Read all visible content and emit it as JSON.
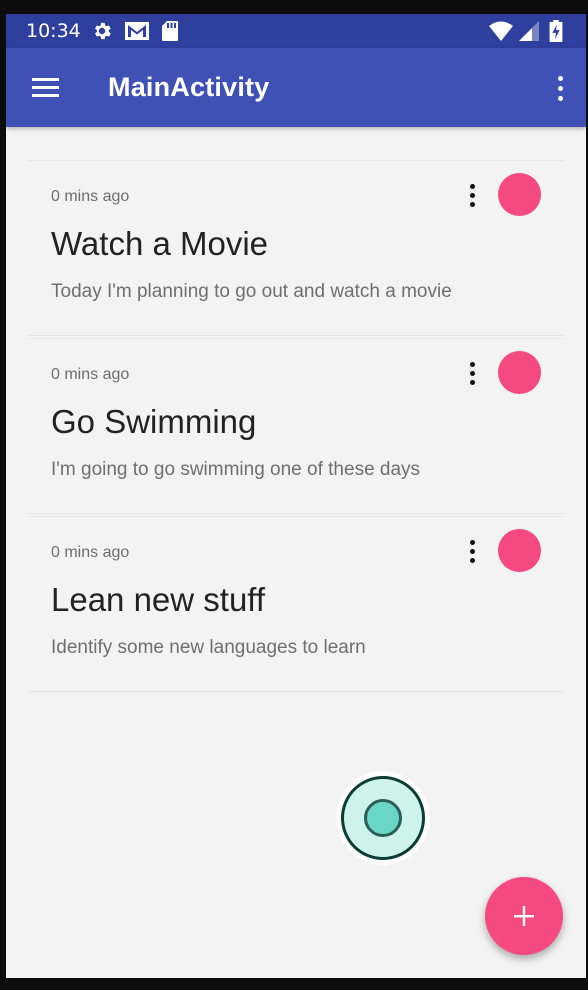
{
  "status_bar": {
    "time": "10:34",
    "icons": [
      "settings-icon",
      "gmail-icon",
      "sd-card-icon",
      "wifi-icon",
      "signal-icon",
      "battery-charging-icon"
    ]
  },
  "app_bar": {
    "title": "MainActivity",
    "nav_icon": "menu-icon",
    "overflow_icon": "more-vert-icon"
  },
  "notes": [
    {
      "time": "0 mins ago",
      "title": "Watch a Movie",
      "description": "Today I'm planning to go out and watch a movie"
    },
    {
      "time": "0 mins ago",
      "title": "Go Swimming",
      "description": "I'm going to go swimming one of these days"
    },
    {
      "time": "0 mins ago",
      "title": "Lean new stuff",
      "description": "Identify some new languages to learn"
    }
  ],
  "fab": {
    "icon": "add-icon"
  },
  "colors": {
    "status_bar": "#2f3f9e",
    "app_bar": "#3f51b5",
    "accent": "#f44a7f",
    "background": "#f3f3f3"
  }
}
